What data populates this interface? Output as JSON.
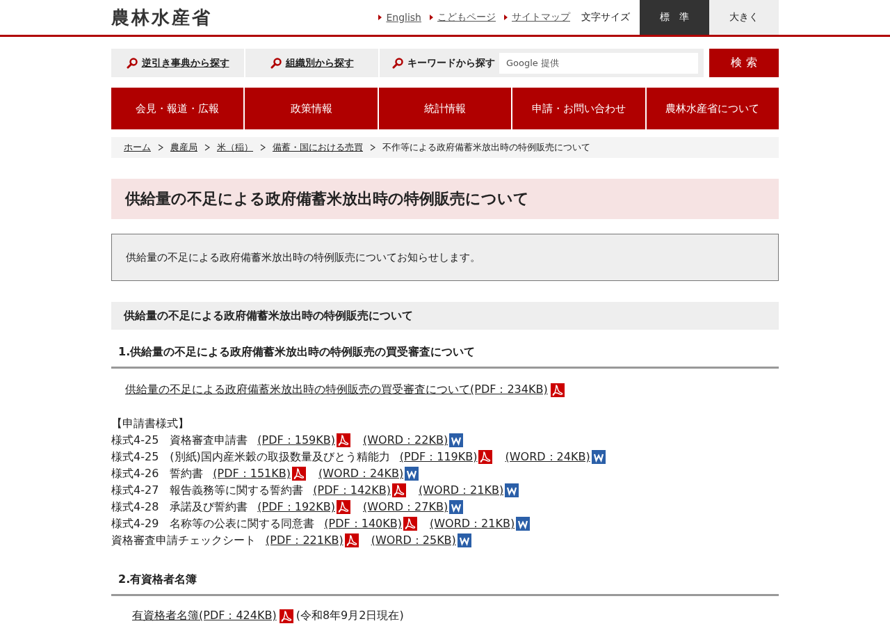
{
  "header": {
    "logo": "農林水産省",
    "links": [
      "English",
      "こどもページ",
      "サイトマップ"
    ],
    "font_size_label": "文字サイズ",
    "font_sizes": [
      {
        "label": "標　準",
        "selected": true
      },
      {
        "label": "大きく",
        "selected": false
      }
    ]
  },
  "search": {
    "links": [
      "逆引き事典から探す",
      "組織別から探す"
    ],
    "keyword_label": "キーワードから探す",
    "placeholder": "Google 提供",
    "button": "検 索"
  },
  "nav": [
    "会見・報道・広報",
    "政策情報",
    "統計情報",
    "申請・お問い合わせ",
    "農林水産省について"
  ],
  "breadcrumb": {
    "links": [
      "ホーム",
      "農産局",
      "米（稲）",
      "備蓄・国における売買"
    ],
    "current": "不作等による政府備蓄米放出時の特例販売について"
  },
  "title": "供給量の不足による政府備蓄米放出時の特例販売について",
  "notice": "供給量の不足による政府備蓄米放出時の特例販売についてお知らせします。",
  "section_title": "供給量の不足による政府備蓄米放出時の特例販売について",
  "sub1": {
    "heading": "1.供給量の不足による政府備蓄米放出時の特例販売の買受審査について",
    "link": {
      "text": "供給量の不足による政府備蓄米放出時の特例販売の買受審査について(PDF：234KB)",
      "kind": "pdf"
    }
  },
  "forms": {
    "heading": "【申請書様式】",
    "rows": [
      {
        "label": "様式4-25　資格審査申請書",
        "files": [
          {
            "text": "(PDF：159KB)",
            "kind": "pdf"
          },
          {
            "text": "(WORD：22KB)",
            "kind": "word"
          }
        ]
      },
      {
        "label": "様式4-25　(別紙)国内産米穀の取扱数量及びとう精能力",
        "files": [
          {
            "text": "(PDF：119KB)",
            "kind": "pdf"
          },
          {
            "text": "(WORD：24KB)",
            "kind": "word"
          }
        ]
      },
      {
        "label": "様式4-26　誓約書",
        "files": [
          {
            "text": "(PDF：151KB)",
            "kind": "pdf"
          },
          {
            "text": "(WORD：24KB)",
            "kind": "word"
          }
        ]
      },
      {
        "label": "様式4-27　報告義務等に関する誓約書",
        "files": [
          {
            "text": "(PDF：142KB)",
            "kind": "pdf"
          },
          {
            "text": "(WORD：21KB)",
            "kind": "word"
          }
        ]
      },
      {
        "label": "様式4-28　承諾及び誓約書",
        "files": [
          {
            "text": "(PDF：192KB)",
            "kind": "pdf"
          },
          {
            "text": "(WORD：27KB)",
            "kind": "word"
          }
        ]
      },
      {
        "label": "様式4-29　名称等の公表に関する同意書",
        "files": [
          {
            "text": "(PDF：140KB)",
            "kind": "pdf"
          },
          {
            "text": "(WORD：21KB)",
            "kind": "word"
          }
        ]
      },
      {
        "label": "資格審査申請チェックシート",
        "files": [
          {
            "text": "(PDF：221KB)",
            "kind": "pdf"
          },
          {
            "text": "(WORD：25KB)",
            "kind": "word"
          }
        ]
      }
    ]
  },
  "sub2": {
    "heading": "2.有資格者名簿",
    "link": {
      "text": "有資格者名簿(PDF：424KB)",
      "kind": "pdf"
    },
    "note": "(令和8年9月2日現在)"
  }
}
